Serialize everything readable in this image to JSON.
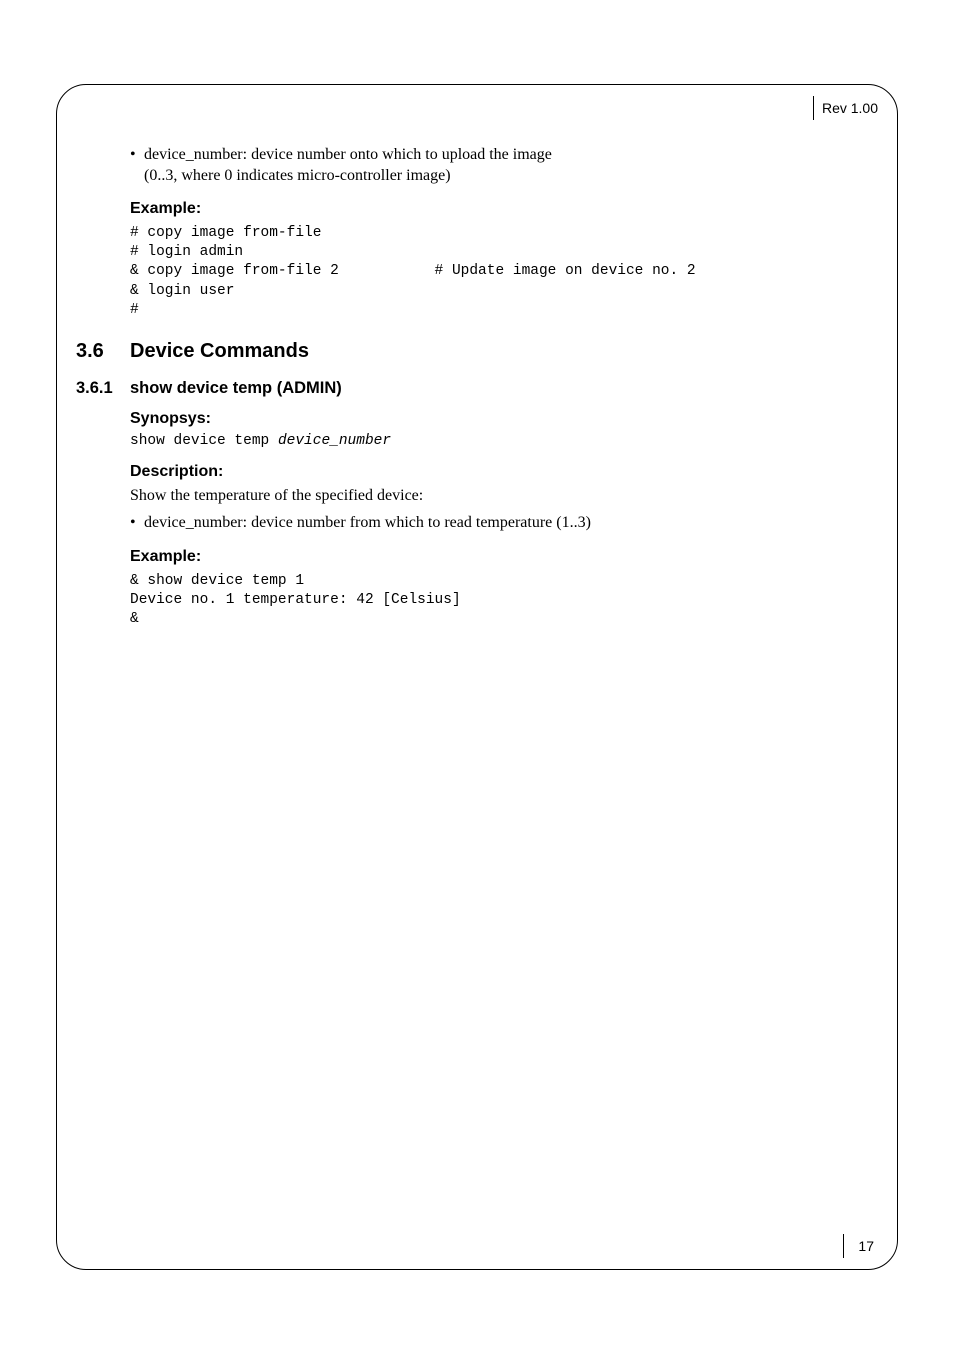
{
  "header": {
    "rev": "Rev 1.00"
  },
  "footer": {
    "page": "17"
  },
  "intro_bullet": {
    "line1": "device_number: device number onto which to upload the image",
    "line2": "(0..3, where 0 indicates micro-controller image)"
  },
  "labels": {
    "example": "Example:",
    "synopsys": "Synopsys:",
    "description": "Description:"
  },
  "code1": "# copy image from-file\n# login admin\n& copy image from-file 2           # Update image on device no. 2\n& login user\n#",
  "sec36": {
    "num": "3.6",
    "title": "Device Commands"
  },
  "sec361": {
    "num": "3.6.1",
    "title": "show device temp (ADMIN)"
  },
  "synopsys_cmd": {
    "fixed": "show device temp ",
    "arg": "device_number"
  },
  "description_text": "Show the temperature of the specified device:",
  "desc_bullet": "device_number: device number from which to read temperature (1..3)",
  "code2": "& show device temp 1\nDevice no. 1 temperature: 42 [Celsius]\n&"
}
